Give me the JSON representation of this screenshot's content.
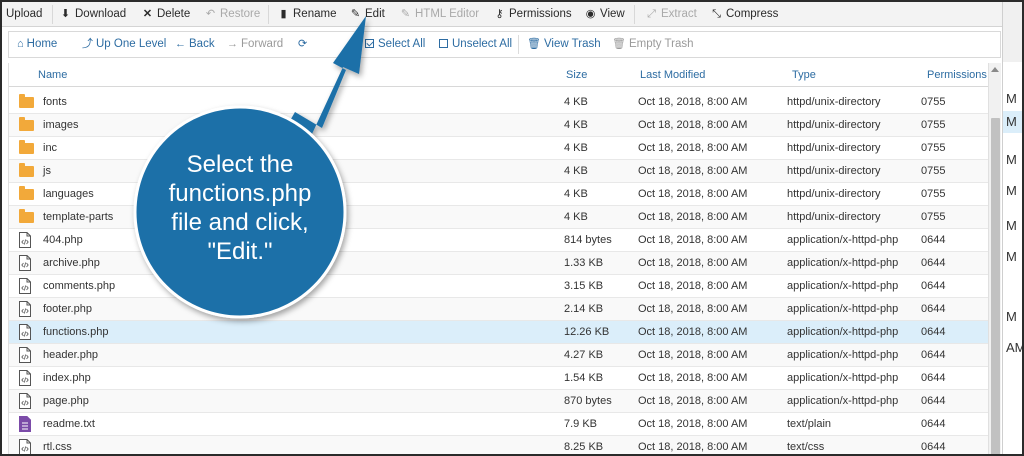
{
  "toolbar": {
    "upload": "Upload",
    "download": "Download",
    "delete": "Delete",
    "restore": "Restore",
    "rename": "Rename",
    "edit": "Edit",
    "html_editor": "HTML Editor",
    "permissions": "Permissions",
    "view": "View",
    "extract": "Extract",
    "compress": "Compress"
  },
  "navbar": {
    "home": "Home",
    "up_one_level": "Up One Level",
    "back": "Back",
    "forward": "Forward",
    "select_all": "Select All",
    "unselect_all": "Unselect All",
    "view_trash": "View Trash",
    "empty_trash": "Empty Trash"
  },
  "table": {
    "headers": {
      "name": "Name",
      "size": "Size",
      "last_modified": "Last Modified",
      "type": "Type",
      "permissions": "Permissions"
    },
    "rows": [
      {
        "icon": "folder-icon",
        "name": "fonts",
        "size": "4 KB",
        "modified": "Oct 18, 2018, 8:00 AM",
        "type": "httpd/unix-directory",
        "perms": "0755"
      },
      {
        "icon": "folder-icon",
        "name": "images",
        "size": "4 KB",
        "modified": "Oct 18, 2018, 8:00 AM",
        "type": "httpd/unix-directory",
        "perms": "0755"
      },
      {
        "icon": "folder-icon",
        "name": "inc",
        "size": "4 KB",
        "modified": "Oct 18, 2018, 8:00 AM",
        "type": "httpd/unix-directory",
        "perms": "0755"
      },
      {
        "icon": "folder-icon",
        "name": "js",
        "size": "4 KB",
        "modified": "Oct 18, 2018, 8:00 AM",
        "type": "httpd/unix-directory",
        "perms": "0755"
      },
      {
        "icon": "folder-icon",
        "name": "languages",
        "size": "4 KB",
        "modified": "Oct 18, 2018, 8:00 AM",
        "type": "httpd/unix-directory",
        "perms": "0755"
      },
      {
        "icon": "folder-icon",
        "name": "template-parts",
        "size": "4 KB",
        "modified": "Oct 18, 2018, 8:00 AM",
        "type": "httpd/unix-directory",
        "perms": "0755"
      },
      {
        "icon": "php-file-icon",
        "name": "404.php",
        "size": "814 bytes",
        "modified": "Oct 18, 2018, 8:00 AM",
        "type": "application/x-httpd-php",
        "perms": "0644"
      },
      {
        "icon": "php-file-icon",
        "name": "archive.php",
        "size": "1.33 KB",
        "modified": "Oct 18, 2018, 8:00 AM",
        "type": "application/x-httpd-php",
        "perms": "0644"
      },
      {
        "icon": "php-file-icon",
        "name": "comments.php",
        "size": "3.15 KB",
        "modified": "Oct 18, 2018, 8:00 AM",
        "type": "application/x-httpd-php",
        "perms": "0644"
      },
      {
        "icon": "php-file-icon",
        "name": "footer.php",
        "size": "2.14 KB",
        "modified": "Oct 18, 2018, 8:00 AM",
        "type": "application/x-httpd-php",
        "perms": "0644"
      },
      {
        "icon": "php-file-icon",
        "name": "functions.php",
        "size": "12.26 KB",
        "modified": "Oct 18, 2018, 8:00 AM",
        "type": "application/x-httpd-php",
        "perms": "0644",
        "selected": true
      },
      {
        "icon": "php-file-icon",
        "name": "header.php",
        "size": "4.27 KB",
        "modified": "Oct 18, 2018, 8:00 AM",
        "type": "application/x-httpd-php",
        "perms": "0644"
      },
      {
        "icon": "php-file-icon",
        "name": "index.php",
        "size": "1.54 KB",
        "modified": "Oct 18, 2018, 8:00 AM",
        "type": "application/x-httpd-php",
        "perms": "0644"
      },
      {
        "icon": "php-file-icon",
        "name": "page.php",
        "size": "870 bytes",
        "modified": "Oct 18, 2018, 8:00 AM",
        "type": "application/x-httpd-php",
        "perms": "0644"
      },
      {
        "icon": "text-file-icon",
        "name": "readme.txt",
        "size": "7.9 KB",
        "modified": "Oct 18, 2018, 8:00 AM",
        "type": "text/plain",
        "perms": "0644"
      },
      {
        "icon": "css-file-icon",
        "name": "rtl.css",
        "size": "8.25 KB",
        "modified": "Oct 18, 2018, 8:00 AM",
        "type": "text/css",
        "perms": "0644"
      }
    ]
  },
  "gutter": [
    "M",
    "M",
    "M",
    "M",
    "M",
    "M",
    "M",
    "AM"
  ],
  "callout": {
    "text_lines": [
      "Select the",
      "functions.php",
      "file and click,",
      "\"Edit.\""
    ],
    "color": "#1b6fa8"
  },
  "colors": {
    "link": "#2d6ca2",
    "folder": "#f2a93a",
    "selected_row": "#dbeefa"
  }
}
